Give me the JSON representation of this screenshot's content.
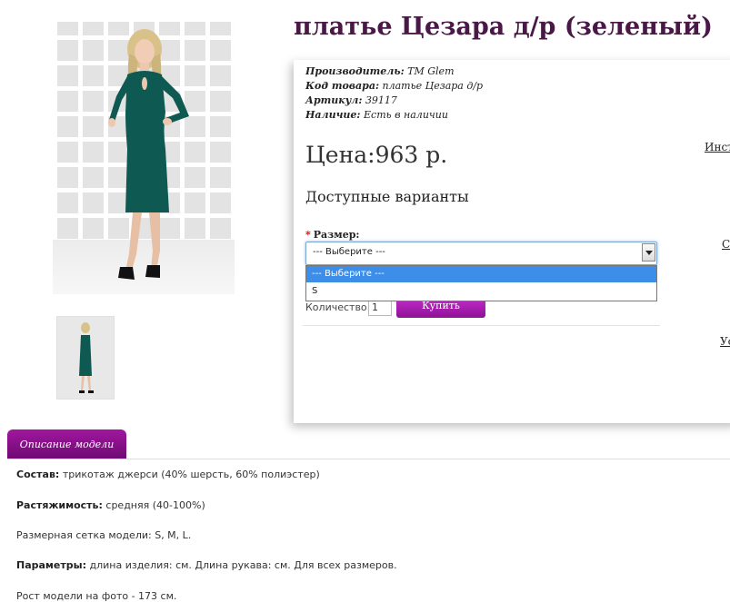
{
  "product": {
    "title": "платье Цезара д/р (зеленый)",
    "manufacturer_label": "Производитель:",
    "manufacturer_value": "ТМ Glem",
    "code_label": "Код товара:",
    "code_value": "платье Цезара д/р",
    "article_label": "Артикул:",
    "article_value": "39117",
    "availability_label": "Наличие:",
    "availability_value": "Есть в наличии",
    "price": "Цена:963 р."
  },
  "options": {
    "heading": "Доступные варианты",
    "size_label": "Размер:",
    "size_required_mark": "*",
    "size_selected": "--- Выберите ---",
    "size_options": [
      "--- Выберите ---",
      "S"
    ]
  },
  "cart": {
    "quantity_label": "Количество:",
    "quantity_value": "1",
    "buy_label": "Купить"
  },
  "side_links": [
    "Инст",
    "С",
    "Ус"
  ],
  "tabs": {
    "description": "Описание модели"
  },
  "description": [
    {
      "label": "Состав:",
      "value": "трикотаж джерси (40% шерсть, 60% полиэстер)"
    },
    {
      "label": "Растяжимость:",
      "value": "средняя (40-100%)"
    },
    {
      "label": "",
      "value": "Размерная сетка модели: S, M, L."
    },
    {
      "label": "Параметры:",
      "value": "длина изделия: см. Длина рукава: см. Для всех размеров."
    },
    {
      "label": "",
      "value": "Рост модели на фото - 173 см."
    }
  ],
  "colors": {
    "title": "#4a1846",
    "accent": "#9c179b",
    "dress": "#0e5a52",
    "select_highlight": "#3d8ee8"
  }
}
